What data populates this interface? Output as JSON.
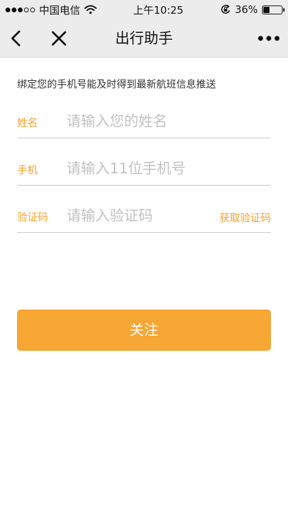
{
  "status_bar": {
    "carrier": "中国电信",
    "time": "上午10:25",
    "battery": "36%",
    "battery_level": 0.36,
    "signal_bars_filled": 3,
    "signal_bars_total": 5
  },
  "nav": {
    "title": "出行助手"
  },
  "form": {
    "hint": "绑定您的手机号能及时得到最新航班信息推送",
    "name_label": "姓名",
    "name_placeholder": "请输入您的姓名",
    "phone_label": "手机",
    "phone_placeholder": "请输入11位手机号",
    "code_label": "验证码",
    "code_placeholder": "请输入验证码",
    "get_code_label": "获取验证码",
    "submit_label": "关注"
  },
  "colors": {
    "accent": "#f5a12e",
    "button": "#f7a733",
    "nav_background": "#ececec"
  }
}
